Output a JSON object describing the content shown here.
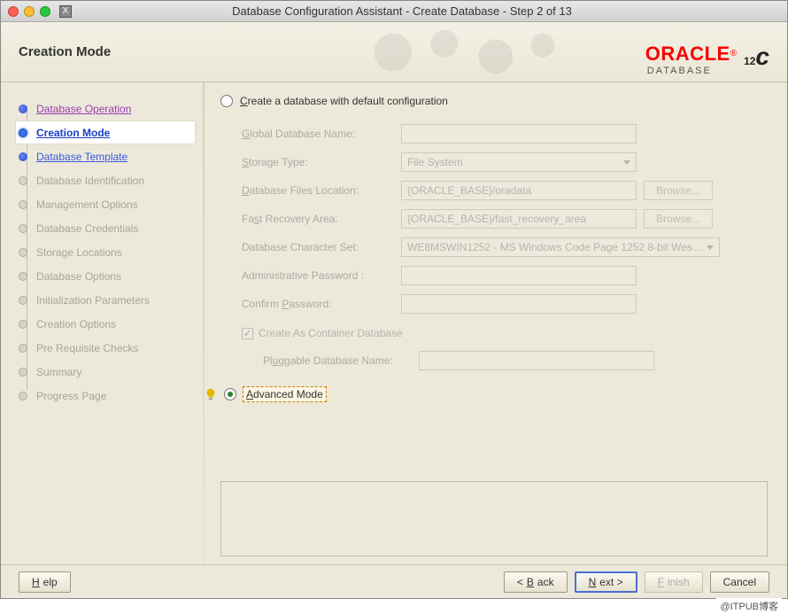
{
  "window": {
    "title": "Database Configuration Assistant - Create Database - Step 2 of 13"
  },
  "header": {
    "title": "Creation Mode",
    "brand_main": "ORACLE",
    "brand_sub": "DATABASE",
    "brand_version": "12",
    "brand_version_suffix": "c"
  },
  "sidebar": {
    "items": [
      {
        "label": "Database Operation",
        "state": "done link"
      },
      {
        "label": "Creation Mode",
        "state": "current"
      },
      {
        "label": "Database Template",
        "state": "done link template"
      },
      {
        "label": "Database Identification",
        "state": ""
      },
      {
        "label": "Management Options",
        "state": ""
      },
      {
        "label": "Database Credentials",
        "state": ""
      },
      {
        "label": "Storage Locations",
        "state": ""
      },
      {
        "label": "Database Options",
        "state": ""
      },
      {
        "label": "Initialization Parameters",
        "state": ""
      },
      {
        "label": "Creation Options",
        "state": ""
      },
      {
        "label": "Pre Requisite Checks",
        "state": ""
      },
      {
        "label": "Summary",
        "state": ""
      },
      {
        "label": "Progress Page",
        "state": ""
      }
    ]
  },
  "form": {
    "radio_default": "Create a database with default configuration",
    "radio_advanced": "Advanced Mode",
    "global_db_name_label": "Global Database Name:",
    "storage_type_label": "Storage Type:",
    "storage_type_value": "File System",
    "db_files_location_label": "Database Files Location:",
    "db_files_location_value": "{ORACLE_BASE}/oradata",
    "fast_recovery_label": "Fast Recovery Area:",
    "fast_recovery_value": "{ORACLE_BASE}/fast_recovery_area",
    "charset_label": "Database Character Set:",
    "charset_value": "WE8MSWIN1252 - MS Windows Code Page 1252 8-bit Wes…",
    "admin_pw_label": "Administrative Password :",
    "confirm_pw_label": "Confirm Password:",
    "container_cb_label": "Create As Container Database",
    "plug_db_label": "Pluggable Database Name:",
    "browse": "Browse..."
  },
  "footer": {
    "help": "Help",
    "back": "Back",
    "next": "Next",
    "finish": "Finish",
    "cancel": "Cancel"
  },
  "watermark": "@ITPUB博客"
}
